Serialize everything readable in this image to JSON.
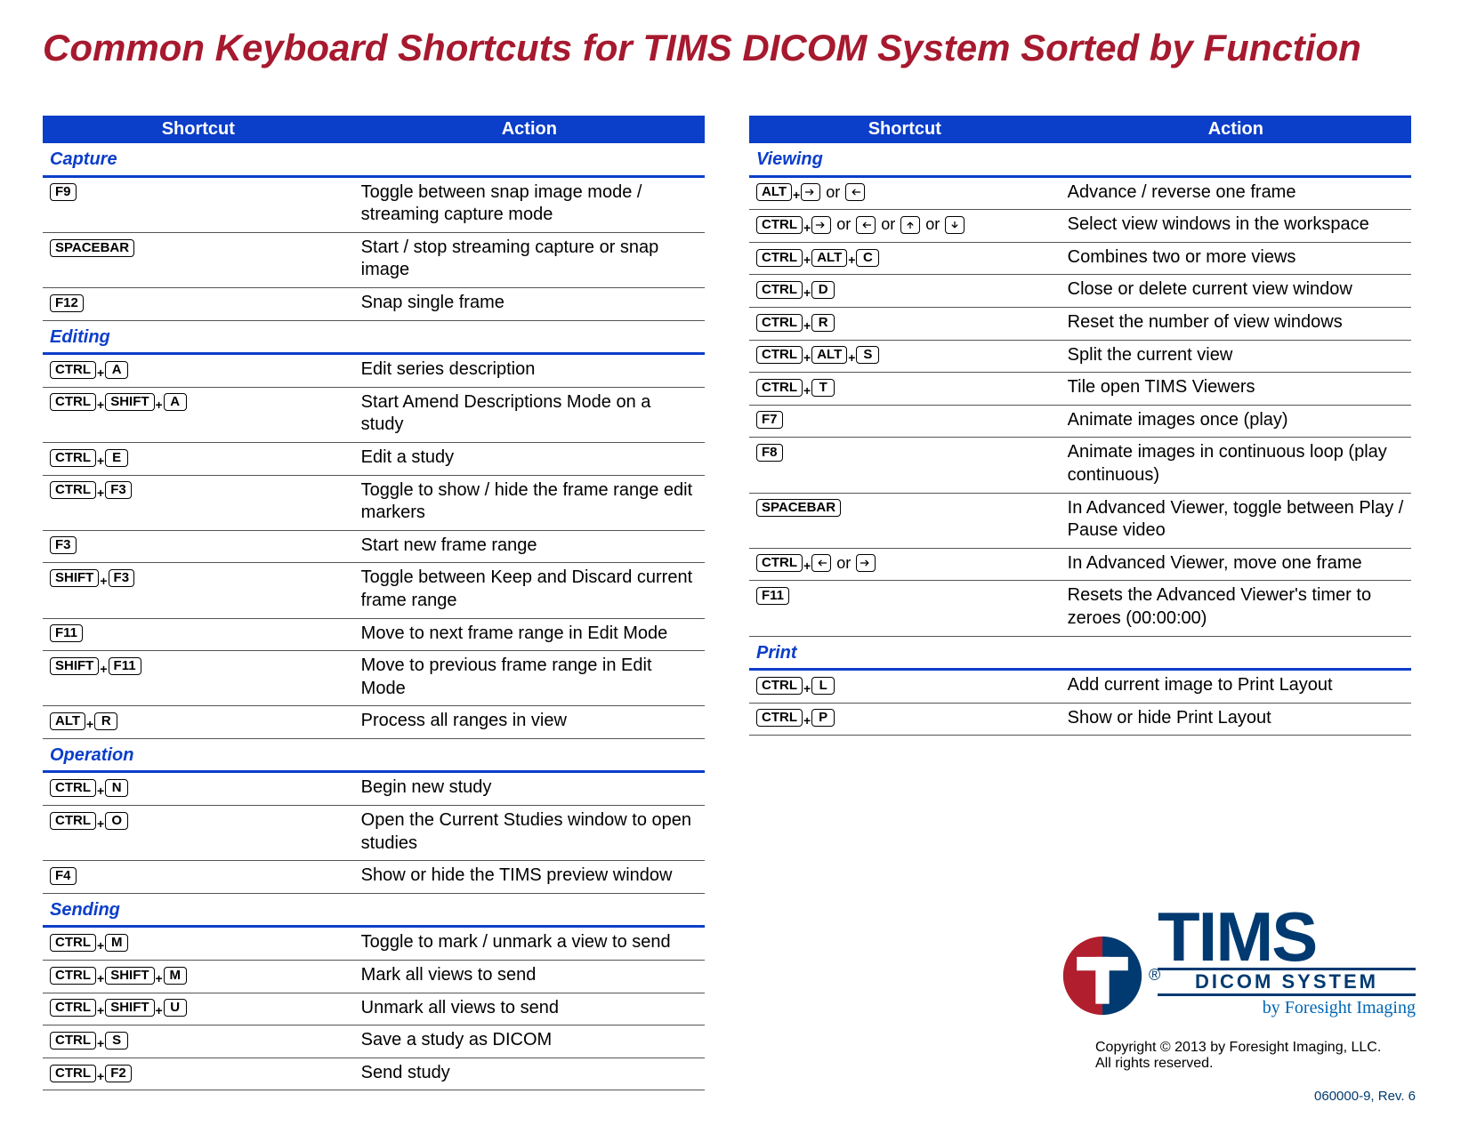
{
  "title": "Common Keyboard Shortcuts for TIMS DICOM System Sorted by Function",
  "headers": {
    "shortcut": "Shortcut",
    "action": "Action"
  },
  "left": [
    {
      "category": "Capture",
      "rows": [
        {
          "keys": [
            [
              "F9"
            ]
          ],
          "action": "Toggle between snap image mode / streaming capture mode"
        },
        {
          "keys": [
            [
              "SPACEBAR"
            ]
          ],
          "action": "Start / stop streaming capture or snap image"
        },
        {
          "keys": [
            [
              "F12"
            ]
          ],
          "action": "Snap single frame"
        }
      ]
    },
    {
      "category": "Editing",
      "rows": [
        {
          "keys": [
            [
              "CTRL",
              "A"
            ]
          ],
          "action": "Edit series description"
        },
        {
          "keys": [
            [
              "CTRL",
              "SHIFT",
              "A"
            ]
          ],
          "action": "Start Amend Descriptions Mode on a study"
        },
        {
          "keys": [
            [
              "CTRL",
              "E"
            ]
          ],
          "action": "Edit a study"
        },
        {
          "keys": [
            [
              "CTRL",
              "F3"
            ]
          ],
          "action": "Toggle to show / hide the frame range edit markers"
        },
        {
          "keys": [
            [
              "F3"
            ]
          ],
          "action": "Start new frame range"
        },
        {
          "keys": [
            [
              "SHIFT",
              "F3"
            ]
          ],
          "action": "Toggle between Keep and Discard current frame range"
        },
        {
          "keys": [
            [
              "F11"
            ]
          ],
          "action": "Move to next frame range in Edit Mode"
        },
        {
          "keys": [
            [
              "SHIFT",
              "F11"
            ]
          ],
          "action": "Move to previous frame range in Edit Mode"
        },
        {
          "keys": [
            [
              "ALT",
              "R"
            ]
          ],
          "action": "Process all ranges in view"
        }
      ]
    },
    {
      "category": "Operation",
      "rows": [
        {
          "keys": [
            [
              "CTRL",
              "N"
            ]
          ],
          "action": "Begin new study"
        },
        {
          "keys": [
            [
              "CTRL",
              "O"
            ]
          ],
          "action": "Open the Current Studies window to open studies"
        },
        {
          "keys": [
            [
              "F4"
            ]
          ],
          "action": "Show or hide the TIMS preview window"
        }
      ]
    },
    {
      "category": "Sending",
      "rows": [
        {
          "keys": [
            [
              "CTRL",
              "M"
            ]
          ],
          "action": "Toggle to mark / unmark a view to send"
        },
        {
          "keys": [
            [
              "CTRL",
              "SHIFT",
              "M"
            ]
          ],
          "action": "Mark all views to send"
        },
        {
          "keys": [
            [
              "CTRL",
              "SHIFT",
              "U"
            ]
          ],
          "action": "Unmark all views to send"
        },
        {
          "keys": [
            [
              "CTRL",
              "S"
            ]
          ],
          "action": "Save a study as DICOM"
        },
        {
          "keys": [
            [
              "CTRL",
              "F2"
            ]
          ],
          "action": "Send study"
        }
      ]
    }
  ],
  "right": [
    {
      "category": "Viewing",
      "rows": [
        {
          "keys": [
            [
              "ALT",
              "→"
            ],
            [
              "←"
            ]
          ],
          "sep": "or",
          "action": "Advance / reverse one frame"
        },
        {
          "keys": [
            [
              "CTRL",
              "→"
            ],
            [
              "←"
            ],
            [
              "↑"
            ],
            [
              "↓"
            ]
          ],
          "sep": "or",
          "action": "Select view windows in the workspace"
        },
        {
          "keys": [
            [
              "CTRL",
              "ALT",
              "C"
            ]
          ],
          "action": "Combines two or more views"
        },
        {
          "keys": [
            [
              "CTRL",
              "D"
            ]
          ],
          "action": "Close or delete current view window"
        },
        {
          "keys": [
            [
              "CTRL",
              "R"
            ]
          ],
          "action": "Reset the number of view windows"
        },
        {
          "keys": [
            [
              "CTRL",
              "ALT",
              "S"
            ]
          ],
          "action": "Split the current view"
        },
        {
          "keys": [
            [
              "CTRL",
              "T"
            ]
          ],
          "action": "Tile open TIMS Viewers"
        },
        {
          "keys": [
            [
              "F7"
            ]
          ],
          "action": "Animate images once (play)"
        },
        {
          "keys": [
            [
              "F8"
            ]
          ],
          "action": "Animate images in continuous loop (play continuous)"
        },
        {
          "keys": [
            [
              "SPACEBAR"
            ]
          ],
          "action": "In Advanced Viewer, toggle between Play / Pause video"
        },
        {
          "keys": [
            [
              "CTRL",
              "←"
            ],
            [
              "→"
            ]
          ],
          "sep": "or",
          "action": "In Advanced Viewer, move one frame"
        },
        {
          "keys": [
            [
              "F11"
            ]
          ],
          "action": "Resets the Advanced Viewer's timer to zeroes (00:00:00)"
        }
      ]
    },
    {
      "category": "Print",
      "rows": [
        {
          "keys": [
            [
              "CTRL",
              "L"
            ]
          ],
          "action": "Add current image to Print Layout"
        },
        {
          "keys": [
            [
              "CTRL",
              "P"
            ]
          ],
          "action": "Show or hide Print Layout"
        }
      ]
    }
  ],
  "logo": {
    "brand": "TIMS",
    "sub": "DICOM SYSTEM",
    "byline": "by Foresight Imaging",
    "registered": "®"
  },
  "copyright_line1": "Copyright © 2013 by Foresight Imaging, LLC.",
  "copyright_line2": "All rights reserved.",
  "docrev": "060000-9, Rev. 6"
}
